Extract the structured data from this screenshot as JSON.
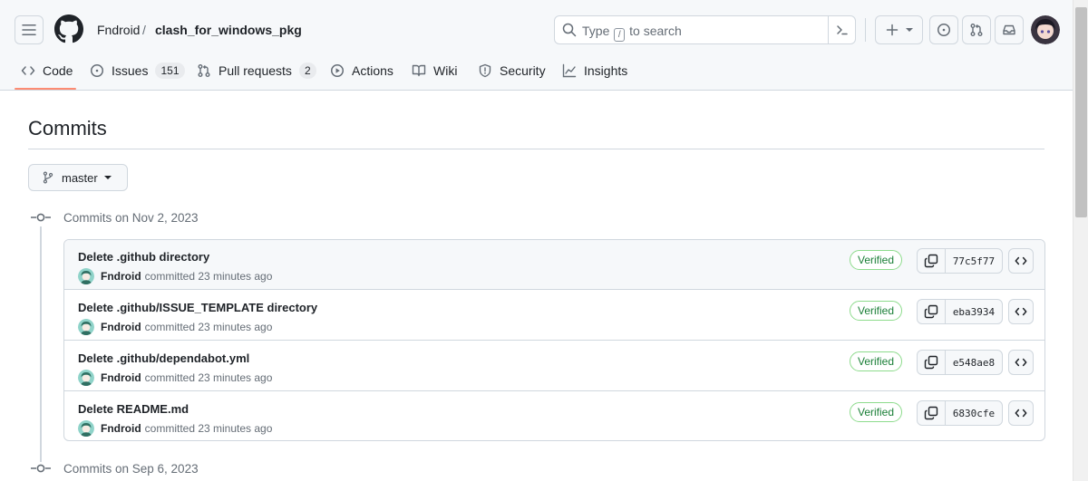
{
  "header": {
    "owner": "Fndroid",
    "separator": "/",
    "repo": "clash_for_windows_pkg",
    "search": {
      "before": "Type",
      "key": "/",
      "after": "to search"
    }
  },
  "tabs": [
    {
      "label": "Code",
      "icon": "code-icon",
      "selected": true
    },
    {
      "label": "Issues",
      "icon": "issue-opened-icon",
      "count": "151"
    },
    {
      "label": "Pull requests",
      "icon": "git-pull-request-icon",
      "count": "2"
    },
    {
      "label": "Actions",
      "icon": "play-icon"
    },
    {
      "label": "Wiki",
      "icon": "book-icon"
    },
    {
      "label": "Security",
      "icon": "shield-icon"
    },
    {
      "label": "Insights",
      "icon": "graph-icon"
    }
  ],
  "page": {
    "title": "Commits",
    "branch": "master"
  },
  "groups": [
    {
      "label": "Commits on Nov 2, 2023",
      "commits": [
        {
          "title": "Delete .github directory",
          "author": "Fndroid",
          "action": "committed 23 minutes ago",
          "badge": "Verified",
          "sha": "77c5f77"
        },
        {
          "title": "Delete .github/ISSUE_TEMPLATE directory",
          "author": "Fndroid",
          "action": "committed 23 minutes ago",
          "badge": "Verified",
          "sha": "eba3934"
        },
        {
          "title": "Delete .github/dependabot.yml",
          "author": "Fndroid",
          "action": "committed 23 minutes ago",
          "badge": "Verified",
          "sha": "e548ae8"
        },
        {
          "title": "Delete README.md",
          "author": "Fndroid",
          "action": "committed 23 minutes ago",
          "badge": "Verified",
          "sha": "6830cfe"
        }
      ]
    },
    {
      "label": "Commits on Sep 6, 2023",
      "commits": []
    }
  ],
  "colors": {
    "accent_underline": "#fd8c73",
    "verified": "#1a7f37",
    "border": "#d0d7de",
    "muted": "#656d76"
  }
}
